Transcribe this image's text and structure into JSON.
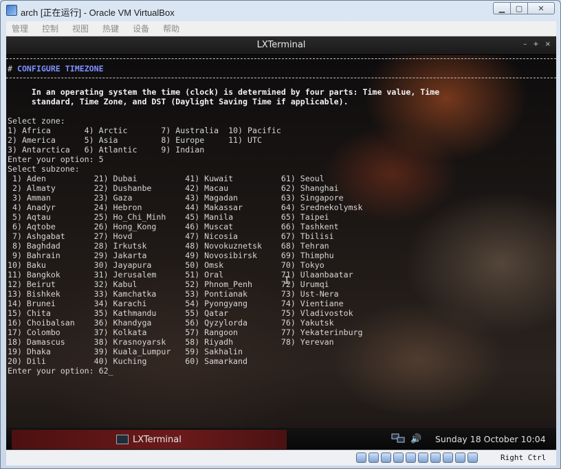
{
  "window": {
    "title": "arch [正在运行] - Oracle VM VirtualBox",
    "controls": {
      "minimize": "▁",
      "maximize": "▢",
      "close": "✕"
    }
  },
  "menu": [
    "管理",
    "控制",
    "视图",
    "热键",
    "设备",
    "帮助"
  ],
  "terminal": {
    "title": "LXTerminal",
    "controls": {
      "minimize": "–",
      "maximize": "+",
      "close": "×"
    },
    "header": {
      "hash": "#",
      "text": "CONFIGURE TIMEZONE"
    },
    "lines": [
      {
        "text": "     In an operating system the time (clock) is determined by four parts: Time value, Time",
        "style": "bold"
      },
      {
        "text": "     standard, Time Zone, and DST (Daylight Saving Time if applicable).",
        "style": "bold"
      },
      {
        "text": "",
        "style": "normal"
      },
      {
        "text": "Select zone:",
        "style": "normal"
      },
      {
        "text": "1) Africa       4) Arctic       7) Australia  10) Pacific",
        "style": "normal"
      },
      {
        "text": "2) America      5) Asia         8) Europe     11) UTC",
        "style": "normal"
      },
      {
        "text": "3) Antarctica   6) Atlantic     9) Indian",
        "style": "normal"
      },
      {
        "text": "Enter your option: 5",
        "style": "normal"
      },
      {
        "text": "Select subzone:",
        "style": "normal"
      },
      {
        "text": " 1) Aden          21) Dubai          41) Kuwait          61) Seoul",
        "style": "normal"
      },
      {
        "text": " 2) Almaty        22) Dushanbe       42) Macau           62) Shanghai",
        "style": "normal"
      },
      {
        "text": " 3) Amman         23) Gaza           43) Magadan         63) Singapore",
        "style": "normal"
      },
      {
        "text": " 4) Anadyr        24) Hebron         44) Makassar        64) Srednekolymsk",
        "style": "normal"
      },
      {
        "text": " 5) Aqtau         25) Ho_Chi_Minh    45) Manila          65) Taipei",
        "style": "normal"
      },
      {
        "text": " 6) Aqtobe        26) Hong_Kong      46) Muscat          66) Tashkent",
        "style": "normal"
      },
      {
        "text": " 7) Ashgabat      27) Hovd           47) Nicosia         67) Tbilisi",
        "style": "normal"
      },
      {
        "text": " 8) Baghdad       28) Irkutsk        48) Novokuznetsk    68) Tehran",
        "style": "normal"
      },
      {
        "text": " 9) Bahrain       29) Jakarta        49) Novosibirsk     69) Thimphu",
        "style": "normal"
      },
      {
        "text": "10) Baku          30) Jayapura       50) Omsk            70) Tokyo",
        "style": "normal"
      },
      {
        "text": "11) Bangkok       31) Jerusalem      51) Oral            71) Ulaanbaatar",
        "style": "normal"
      },
      {
        "text": "12) Beirut        32) Kabul          52) Phnom_Penh      72) Urumqi",
        "style": "normal"
      },
      {
        "text": "13) Bishkek       33) Kamchatka      53) Pontianak       73) Ust-Nera",
        "style": "normal"
      },
      {
        "text": "14) Brunei        34) Karachi        54) Pyongyang       74) Vientiane",
        "style": "normal"
      },
      {
        "text": "15) Chita         35) Kathmandu      55) Qatar           75) Vladivostok",
        "style": "normal"
      },
      {
        "text": "16) Choibalsan    36) Khandyga       56) Qyzylorda       76) Yakutsk",
        "style": "normal"
      },
      {
        "text": "17) Colombo       37) Kolkata        57) Rangoon         77) Yekaterinburg",
        "style": "normal"
      },
      {
        "text": "18) Damascus      38) Krasnoyarsk    58) Riyadh          78) Yerevan",
        "style": "normal"
      },
      {
        "text": "19) Dhaka         39) Kuala_Lumpur   59) Sakhalin",
        "style": "normal"
      },
      {
        "text": "20) Dili          40) Kuching        60) Samarkand",
        "style": "normal"
      },
      {
        "text": "Enter your option: 62_",
        "style": "normal"
      }
    ]
  },
  "taskbar": {
    "task_label": "LXTerminal",
    "volume_icon": "🔊",
    "clock": "Sunday 18 October 10:04"
  },
  "statusbar": {
    "icons": [
      "hdd-icon",
      "optical-disc-icon",
      "network-icon",
      "usb-icon",
      "shared-folder-icon",
      "display-icon",
      "video-capture-icon",
      "recording-icon",
      "cpu-icon",
      "mouse-integration-icon"
    ],
    "host_key": "Right Ctrl"
  }
}
